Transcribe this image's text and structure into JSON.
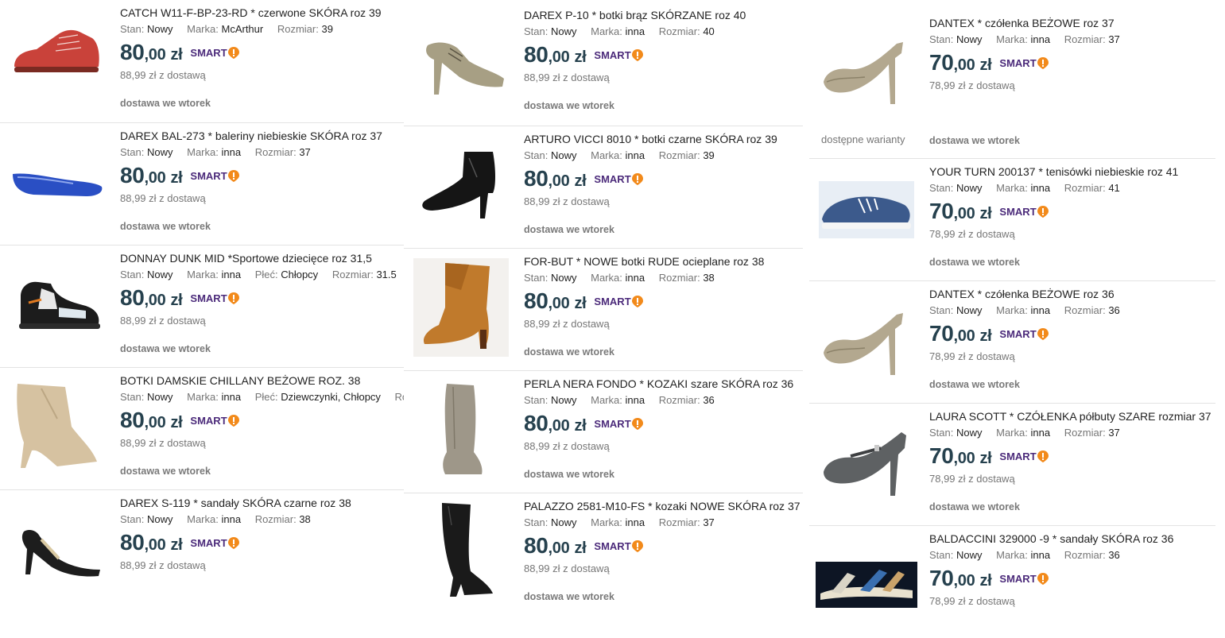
{
  "labels": {
    "condition": "Stan:",
    "brand": "Marka:",
    "size": "Rozmiar:",
    "gender": "Płeć:",
    "smart": "SMART",
    "delivery_day": "dostawa we wtorek",
    "variants": "dostępne warianty"
  },
  "colors": {
    "price": "#26414e",
    "smart_text": "#4b2a7a",
    "smart_badge": "#f28a1b",
    "muted": "#767676"
  },
  "columns": [
    {
      "items": [
        {
          "title": "CATCH W11-F-BP-23-RD * czerwone SKÓRA roz 39",
          "condition": "Nowy",
          "brand": "McArthur",
          "size": "39",
          "price_int": "80",
          "price_dec": ",00",
          "currency": "zł",
          "delivery_price": "88,99 zł z dostawą",
          "image": "red-leather-sneaker",
          "image_color": "#c9423a"
        },
        {
          "title": "DAREX BAL-273 * baleriny niebieskie SKÓRA roz 37",
          "condition": "Nowy",
          "brand": "inna",
          "size": "37",
          "price_int": "80",
          "price_dec": ",00",
          "currency": "zł",
          "delivery_price": "88,99 zł z dostawą",
          "image": "blue-ballerina-flat",
          "image_color": "#2a4fc4"
        },
        {
          "title": "DONNAY DUNK MID *Sportowe dziecięce roz 31,5",
          "condition": "Nowy",
          "brand": "inna",
          "gender": "Chłopcy",
          "size": "31.5",
          "price_int": "80",
          "price_dec": ",00",
          "currency": "zł",
          "delivery_price": "88,99 zł z dostawą",
          "image": "kids-sport-sneaker",
          "image_color": "#222222"
        },
        {
          "title": "BOTKI DAMSKIE CHILLANY BEŻOWE ROZ. 38",
          "condition": "Nowy",
          "brand": "inna",
          "gender": "Dziewczynki, Chłopcy",
          "size_cut": "Ro",
          "price_int": "80",
          "price_dec": ",00",
          "currency": "zł",
          "delivery_price": "88,99 zł z dostawą",
          "image": "beige-suede-ankle-boot",
          "image_color": "#d6c2a1"
        },
        {
          "title": "DAREX S-119 * sandały SKÓRA czarne roz 38",
          "condition": "Nowy",
          "brand": "inna",
          "size": "38",
          "price_int": "80",
          "price_dec": ",00",
          "currency": "zł",
          "delivery_price": "88,99 zł z dostawą",
          "image": "black-heeled-sandal",
          "image_color": "#1d1d1d"
        }
      ]
    },
    {
      "items": [
        {
          "title": "DAREX P-10 * botki brąz SKÓRZANE roz 40",
          "condition": "Nowy",
          "brand": "inna",
          "size": "40",
          "price_int": "80",
          "price_dec": ",00",
          "currency": "zł",
          "delivery_price": "88,99 zł z dostawą",
          "image": "taupe-lace-up-heel",
          "image_color": "#a79f84"
        },
        {
          "title": "ARTURO VICCI 8010 * botki czarne SKÓRA roz 39",
          "condition": "Nowy",
          "brand": "inna",
          "size": "39",
          "price_int": "80",
          "price_dec": ",00",
          "currency": "zł",
          "delivery_price": "88,99 zł z dostawą",
          "image": "black-heeled-bootie",
          "image_color": "#151515"
        },
        {
          "title": "FOR-BUT * NOWE botki RUDE ocieplane roz 38",
          "condition": "Nowy",
          "brand": "inna",
          "size": "38",
          "price_int": "80",
          "price_dec": ",00",
          "currency": "zł",
          "delivery_price": "88,99 zł z dostawą",
          "image": "rust-folded-boot",
          "image_color": "#c07a2c"
        },
        {
          "title": "PERLA NERA FONDO * KOZAKI szare SKÓRA roz 36",
          "condition": "Nowy",
          "brand": "inna",
          "size": "36",
          "price_int": "80",
          "price_dec": ",00",
          "currency": "zł",
          "delivery_price": "88,99 zł z dostawą",
          "image": "grey-knee-boot",
          "image_color": "#9e9789"
        },
        {
          "title": "PALAZZO 2581-M10-FS * kozaki NOWE SKÓRA roz 37",
          "condition": "Nowy",
          "brand": "inna",
          "size": "37",
          "price_int": "80",
          "price_dec": ",00",
          "currency": "zł",
          "delivery_price": "88,99 zł z dostawą",
          "image": "black-tall-boot",
          "image_color": "#1a1a1a"
        }
      ]
    },
    {
      "items": [
        {
          "title": "DANTEX * czółenka BEŻOWE roz 37",
          "condition": "Nowy",
          "brand": "inna",
          "size": "37",
          "price_int": "70",
          "price_dec": ",00",
          "currency": "zł",
          "delivery_price": "78,99 zł z dostawą",
          "image": "beige-pump",
          "image_color": "#b3a88f",
          "has_variants": true
        },
        {
          "title": "YOUR TURN 200137 * tenisówki niebieskie roz 41",
          "condition": "Nowy",
          "brand": "inna",
          "size": "41",
          "price_int": "70",
          "price_dec": ",00",
          "currency": "zł",
          "delivery_price": "78,99 zł z dostawą",
          "image": "blue-canvas-sneaker",
          "image_color": "#3c5a8c"
        },
        {
          "title": "DANTEX * czółenka BEŻOWE roz 36",
          "condition": "Nowy",
          "brand": "inna",
          "size": "36",
          "price_int": "70",
          "price_dec": ",00",
          "currency": "zł",
          "delivery_price": "78,99 zł z dostawą",
          "image": "beige-pump",
          "image_color": "#b3a88f"
        },
        {
          "title": "LAURA SCOTT * CZÓŁENKA półbuty SZARE rozmiar 37",
          "condition": "Nowy",
          "brand": "inna",
          "size": "37",
          "price_int": "70",
          "price_dec": ",00",
          "currency": "zł",
          "delivery_price": "78,99 zł z dostawą",
          "image": "grey-strap-pump",
          "image_color": "#5e6163"
        },
        {
          "title": "BALDACCINI 329000 -9 * sandały SKÓRA roz 36",
          "condition": "Nowy",
          "brand": "inna",
          "size": "36",
          "price_int": "70",
          "price_dec": ",00",
          "currency": "zł",
          "delivery_price": "78,99 zł z dostawą",
          "image": "strappy-flat-sandal",
          "image_color": "#e9e2cf"
        }
      ]
    }
  ]
}
